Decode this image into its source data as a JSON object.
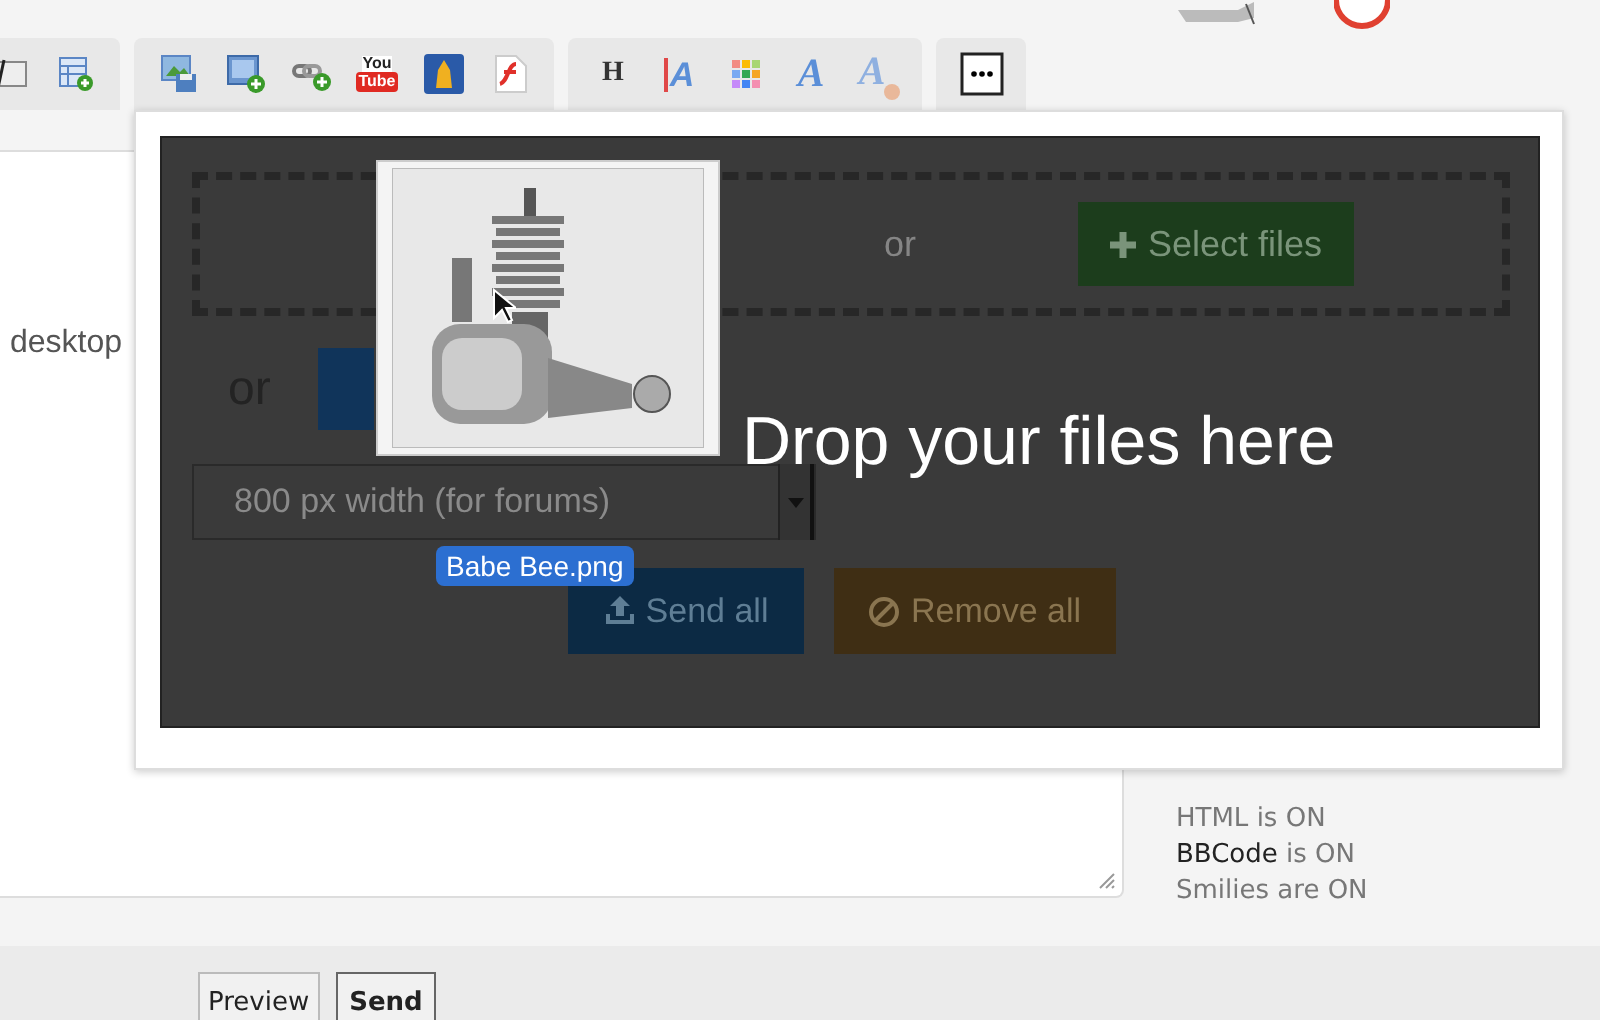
{
  "toolbar": {
    "groups": [
      {
        "buttons": [
          {
            "kind": "frame"
          },
          {
            "kind": "table-add"
          }
        ]
      },
      {
        "buttons": [
          {
            "kind": "image-save"
          },
          {
            "kind": "image-add"
          },
          {
            "kind": "link-add"
          },
          {
            "kind": "video",
            "lines": [
              "You",
              "Tube"
            ]
          },
          {
            "kind": "figure"
          },
          {
            "kind": "flash"
          }
        ]
      },
      {
        "buttons": [
          {
            "kind": "heading",
            "glyph": "H"
          },
          {
            "kind": "text-height",
            "glyph": "A"
          },
          {
            "kind": "palette"
          },
          {
            "kind": "italic",
            "glyph": "A"
          },
          {
            "kind": "remove-format",
            "glyph": "A"
          }
        ]
      },
      {
        "buttons": [
          {
            "kind": "more"
          }
        ]
      }
    ]
  },
  "editor": {
    "text": "desktop"
  },
  "upload_dialog": {
    "zone_or": "or",
    "select_files": "Select files",
    "or": "or",
    "size_select": "800 px width (for forums)",
    "send_all": "Send all",
    "remove_all": "Remove all",
    "drop_hint": "Drop your files here",
    "dragged_file": {
      "name": "Babe Bee.png"
    }
  },
  "sidebar": {
    "status": [
      {
        "label": "HTML",
        "rest": " is ON",
        "link": false
      },
      {
        "label": "BBCode",
        "rest": " is ON",
        "link": true
      },
      {
        "label": "Smilies",
        "rest": " are ON",
        "link": false
      }
    ]
  },
  "footer": {
    "buttons": [
      {
        "label": "Preview",
        "primary": false
      },
      {
        "label": "Send",
        "primary": true
      }
    ]
  }
}
